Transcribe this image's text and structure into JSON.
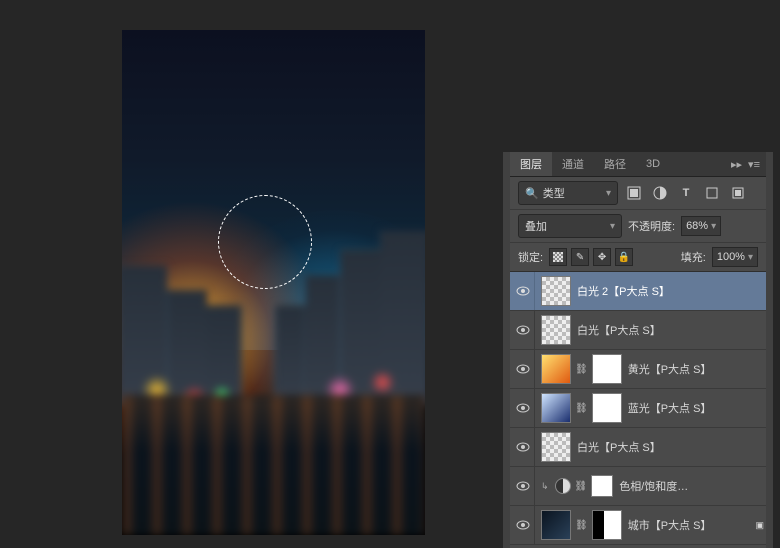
{
  "tabs": {
    "layers": "图层",
    "channels": "通道",
    "paths": "路径",
    "threeD": "3D"
  },
  "filter": {
    "label": "类型"
  },
  "blend": {
    "mode": "叠加",
    "opacity_label": "不透明度:",
    "opacity_value": "68%"
  },
  "lock": {
    "label": "锁定:",
    "fill_label": "填充:",
    "fill_value": "100%"
  },
  "layers": [
    {
      "name": "白光 2【P大点 S】"
    },
    {
      "name": "白光【P大点 S】"
    },
    {
      "name": "黄光【P大点 S】"
    },
    {
      "name": "蓝光【P大点 S】"
    },
    {
      "name": "白光【P大点 S】"
    },
    {
      "name": "色相/饱和度…"
    },
    {
      "name": "城市【P大点 S】"
    }
  ]
}
